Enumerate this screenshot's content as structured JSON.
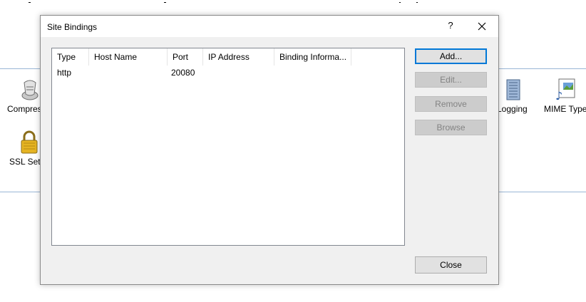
{
  "background": {
    "items": [
      {
        "label": "Compres"
      },
      {
        "label": "SSL Setti"
      },
      {
        "label": "Logging"
      },
      {
        "label": "MIME Type"
      }
    ]
  },
  "dialog": {
    "title": "Site Bindings",
    "help_label": "?",
    "columns": [
      "Type",
      "Host Name",
      "Port",
      "IP Address",
      "Binding Informa..."
    ],
    "rows": [
      {
        "type": "http",
        "host": "",
        "port": "20080",
        "ip": "",
        "info": ""
      }
    ],
    "buttons": {
      "add": "Add...",
      "edit": "Edit...",
      "remove": "Remove",
      "browse": "Browse",
      "close": "Close"
    }
  }
}
